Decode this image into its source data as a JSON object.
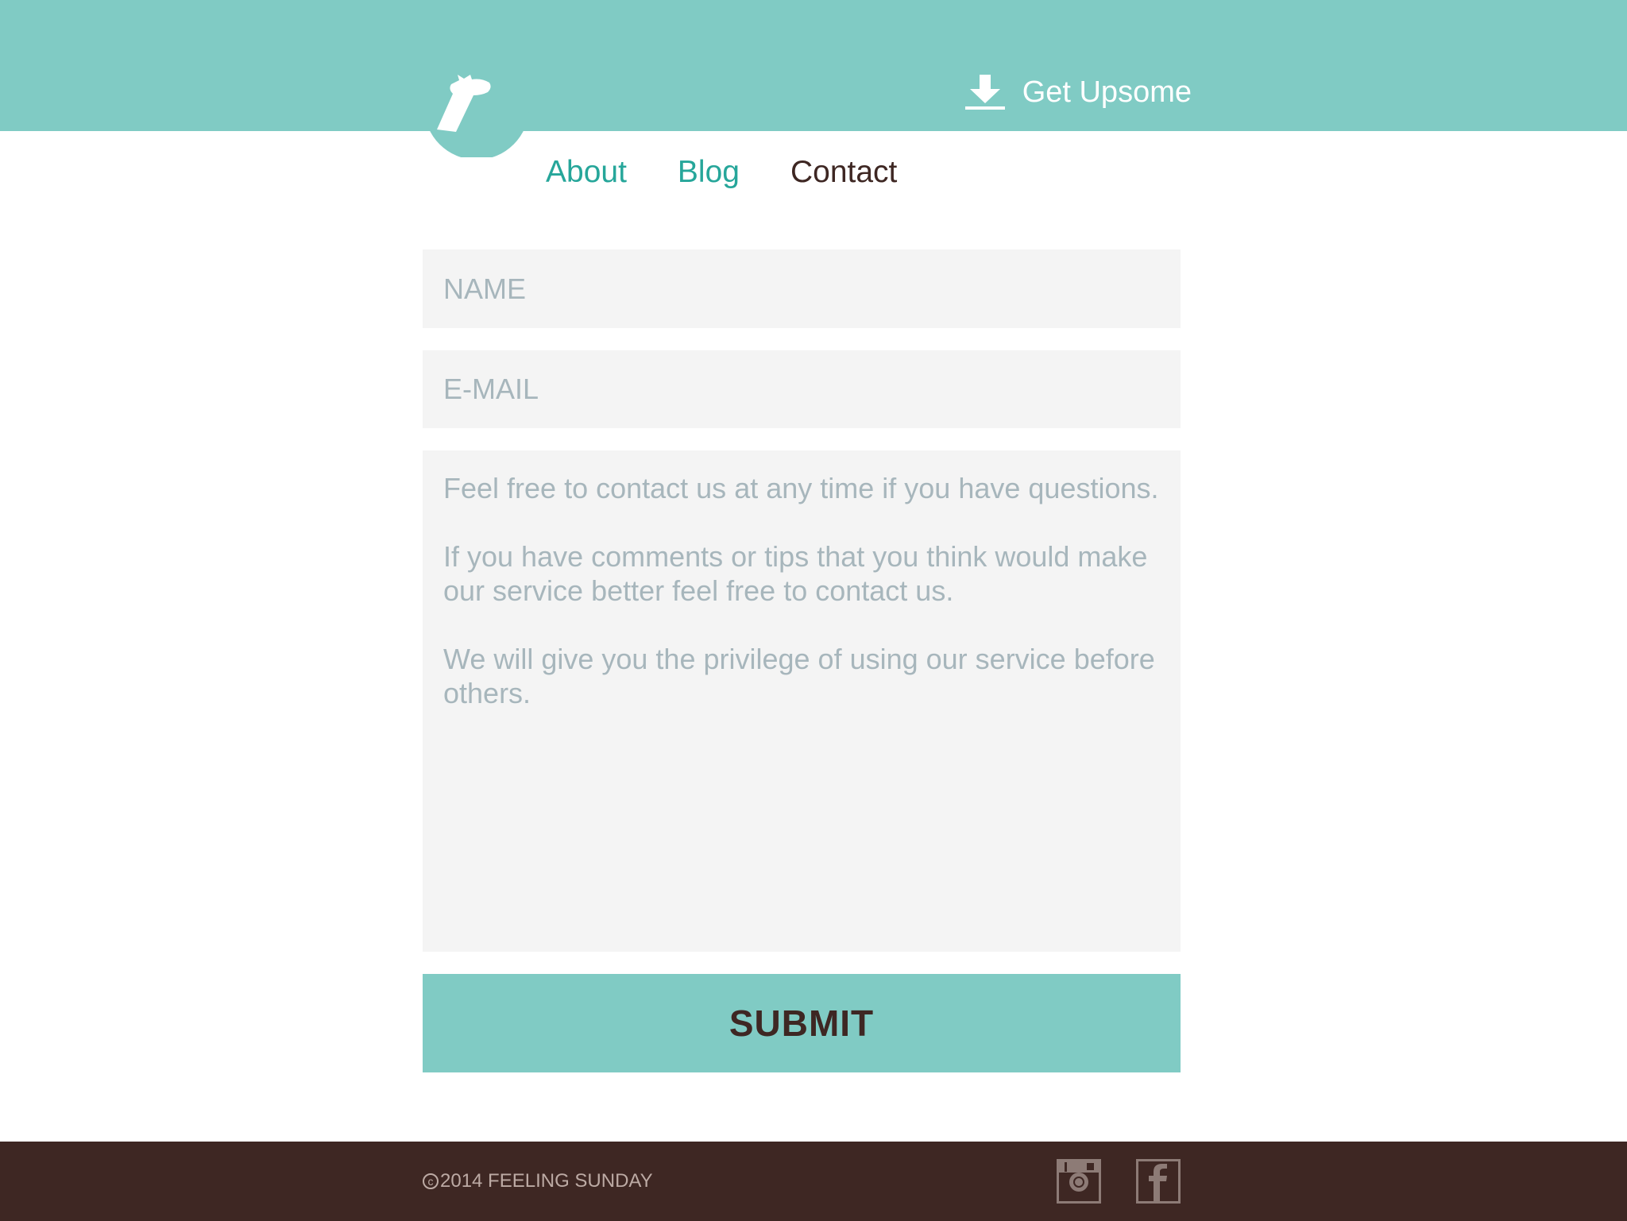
{
  "header": {
    "brand_color": "#80CBC4",
    "cta_label": "Get Upsome",
    "cta_icon": "download-icon"
  },
  "nav": {
    "items": [
      {
        "label": "About",
        "active": false
      },
      {
        "label": "Blog",
        "active": false
      },
      {
        "label": "Contact",
        "active": true
      }
    ]
  },
  "form": {
    "name_placeholder": "NAME",
    "email_placeholder": "E-MAIL",
    "message_placeholder": "Feel free to contact us at any time if you have questions.\n\nIf you have comments or tips that you think would make our service better feel free to contact us.\n\nWe will give you the privilege of using our service before others.",
    "submit_label": "SUBMIT"
  },
  "footer": {
    "copyright_symbol": "c",
    "copyright_text": "2014 FEELING SUNDAY",
    "social_icons": [
      "instagram-icon",
      "facebook-icon"
    ],
    "background_color": "#3E2723"
  }
}
